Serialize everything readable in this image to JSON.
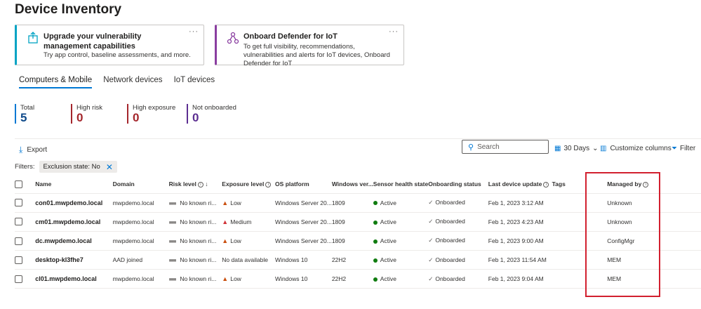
{
  "page": {
    "title": "Device Inventory"
  },
  "cards": [
    {
      "title": "Upgrade your vulnerability management capabilities",
      "description": "Try app control, baseline assessments, and more.",
      "more": "···"
    },
    {
      "title": "Onboard Defender for IoT",
      "description": "To get full visibility, recommendations, vulnerabilities and alerts for IoT devices, Onboard Defender for IoT",
      "more": "···"
    }
  ],
  "tabs": [
    "Computers & Mobile",
    "Network devices",
    "IoT devices"
  ],
  "stats": [
    {
      "label": "Total",
      "value": "5"
    },
    {
      "label": "High risk",
      "value": "0"
    },
    {
      "label": "High exposure",
      "value": "0"
    },
    {
      "label": "Not onboarded",
      "value": "0"
    }
  ],
  "toolbar": {
    "export_label": "Export",
    "search_placeholder": "Search",
    "days_label": "30 Days",
    "customize_label": "Customize columns",
    "filter_label": "Filter"
  },
  "filters": {
    "label": "Filters:",
    "chip": "Exclusion state: No"
  },
  "table": {
    "columns": [
      "Name",
      "Domain",
      "Risk level",
      "Exposure level",
      "OS platform",
      "Windows ver...",
      "Sensor health state",
      "Onboarding status",
      "Last device update",
      "Tags",
      "Managed by"
    ],
    "rows": [
      {
        "name": "con01.mwpdemo.local",
        "domain": "mwpdemo.local",
        "risk": "No known ri...",
        "exposure": "Low",
        "exposure_kind": "low",
        "os": "Windows Server 20...",
        "winver": "1809",
        "sensor": "Active",
        "onboarding": "Onboarded",
        "last_update": "Feb 1, 2023 3:12 AM",
        "tags": "",
        "managed_by": "Unknown"
      },
      {
        "name": "cm01.mwpdemo.local",
        "domain": "mwpdemo.local",
        "risk": "No known ri...",
        "exposure": "Medium",
        "exposure_kind": "med",
        "os": "Windows Server 20...",
        "winver": "1809",
        "sensor": "Active",
        "onboarding": "Onboarded",
        "last_update": "Feb 1, 2023 4:23 AM",
        "tags": "",
        "managed_by": "Unknown"
      },
      {
        "name": "dc.mwpdemo.local",
        "domain": "mwpdemo.local",
        "risk": "No known ri...",
        "exposure": "Low",
        "exposure_kind": "low",
        "os": "Windows Server 20...",
        "winver": "1809",
        "sensor": "Active",
        "onboarding": "Onboarded",
        "last_update": "Feb 1, 2023 9:00 AM",
        "tags": "",
        "managed_by": "ConfigMgr"
      },
      {
        "name": "desktop-kl3fhe7",
        "domain": "AAD joined",
        "risk": "No known ri...",
        "exposure": "No data available",
        "exposure_kind": "none",
        "os": "Windows 10",
        "winver": "22H2",
        "sensor": "Active",
        "onboarding": "Onboarded",
        "last_update": "Feb 1, 2023 11:54 AM",
        "tags": "",
        "managed_by": "MEM"
      },
      {
        "name": "cl01.mwpdemo.local",
        "domain": "mwpdemo.local",
        "risk": "No known ri...",
        "exposure": "Low",
        "exposure_kind": "low",
        "os": "Windows 10",
        "winver": "22H2",
        "sensor": "Active",
        "onboarding": "Onboarded",
        "last_update": "Feb 1, 2023 9:04 AM",
        "tags": "",
        "managed_by": "MEM"
      }
    ]
  },
  "colors": {
    "accent": "#0078d4",
    "risk": "#a4262c",
    "highlight": "#d2202f"
  }
}
